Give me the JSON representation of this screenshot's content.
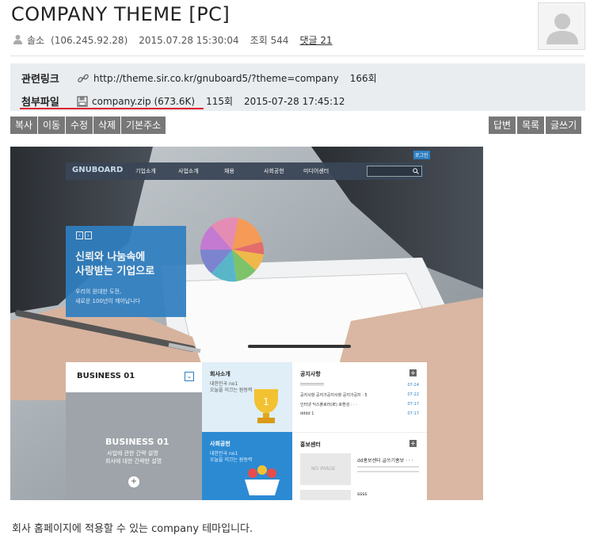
{
  "post": {
    "title": "COMPANY THEME [PC]",
    "author": "솔소",
    "ip": "(106.245.92.28)",
    "datetime": "2015.07.28 15:30:04",
    "views": "조회 544",
    "comments": "댓글 21"
  },
  "links": {
    "label": "관련링크",
    "url": "http://theme.sir.co.kr/gnuboard5/?theme=company",
    "count": "166회"
  },
  "attachments": {
    "label": "첨부파일",
    "file": "company.zip (673.6K)",
    "count": "115회",
    "date": "2015-07-28 17:45:12"
  },
  "toolbar_left": [
    "복사",
    "이동",
    "수정",
    "삭제",
    "기본주소"
  ],
  "toolbar_right": [
    "답변",
    "목록",
    "글쓰기"
  ],
  "preview": {
    "logo": "GNUBOARD",
    "nav": [
      "기업소개",
      "사업소개",
      "채용",
      "사회공헌",
      "미디어센터"
    ],
    "badge": "로그인",
    "hero_title_1": "신뢰와 나눔속에",
    "hero_title_2": "사랑받는 기업으로",
    "hero_sub_1": "우리의 원대한 도전,",
    "hero_sub_2": "새로운 100년이 깨어납니다",
    "business_title": "BUSINESS 01",
    "business_caption_title": "BUSINESS 01",
    "business_caption_1": "사업에 관한 간략 설명",
    "business_caption_2": "회사에 대한 간략한 설명",
    "card1_title": "회사소개",
    "card1_sub_1": "대한민국 no1",
    "card1_sub_2": "오늘을 이끄는 원동력",
    "card2_title": "사회공헌",
    "card2_sub_1": "대한민국 no1",
    "card2_sub_2": "오늘을 이끄는 원동력",
    "notice_title": "공지사항",
    "notice_items": [
      {
        "text": "!!!!!!!!!!!!!!!",
        "date": "07-24"
      },
      {
        "text": "공지사항 공지가공지사항 공지가공지 ·  5",
        "date": "07-22"
      },
      {
        "text": "인터넷 익스플로러(IE) 호환성 · · ·",
        "date": "07-17"
      },
      {
        "text": "dddd 1",
        "date": "07-17"
      }
    ],
    "pr_title": "홍보센터",
    "no_image": "NO IMAGE",
    "pr_item": "dd홍보센터 글쓰기홍보 ·  ·  ·",
    "pr_item2": "ssss"
  },
  "description": "회사 홈페이지에 적용할 수 있는 company 테마입니다.",
  "colors": {
    "button_bg": "#787878",
    "info_bg": "#e9edf0",
    "red_underline": "#dd2233",
    "hero_blue": "#2f7fc1",
    "nav_bg": "#3a4656"
  }
}
